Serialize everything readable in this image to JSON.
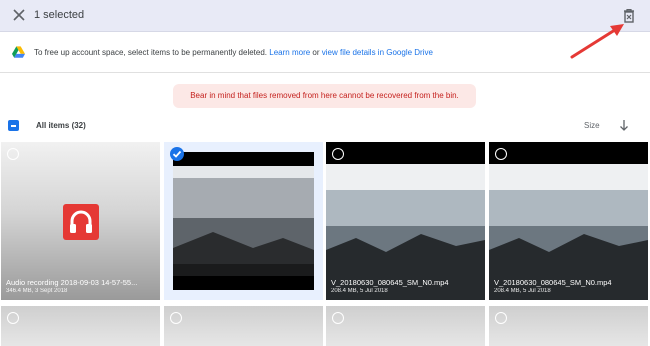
{
  "header": {
    "title": "1 selected"
  },
  "info_bar": {
    "text": "To free up account space, select items to be permanently deleted.",
    "learn_more": "Learn more",
    "or": "or",
    "view_details": "view file details in Google Drive"
  },
  "warning": "Bear in mind that files removed from here cannot be recovered from the bin.",
  "list_header": {
    "all_items": "All items (32)",
    "sort": "Size"
  },
  "items": [
    {
      "name": "Audio recording 2018-09-03 14-57-55...",
      "meta": "346.4 MB, 3 Sept 2018",
      "selected": false
    },
    {
      "name": "",
      "meta": "",
      "selected": true
    },
    {
      "name": "V_20180630_080645_SM_N0.mp4",
      "meta": "208.4 MB, 5 Jul 2018",
      "selected": false
    },
    {
      "name": "V_20180630_080645_SM_N0.mp4",
      "meta": "208.4 MB, 5 Jul 2018",
      "selected": false
    }
  ],
  "colors": {
    "accent": "#1a73e8",
    "warning_bg": "#fce8e6",
    "warning_text": "#c5221f",
    "annotation_arrow": "#e53935"
  },
  "icons": [
    "close-icon",
    "delete-forever-icon",
    "google-drive-icon",
    "arrow-down-icon",
    "headphones-icon",
    "check-icon"
  ]
}
